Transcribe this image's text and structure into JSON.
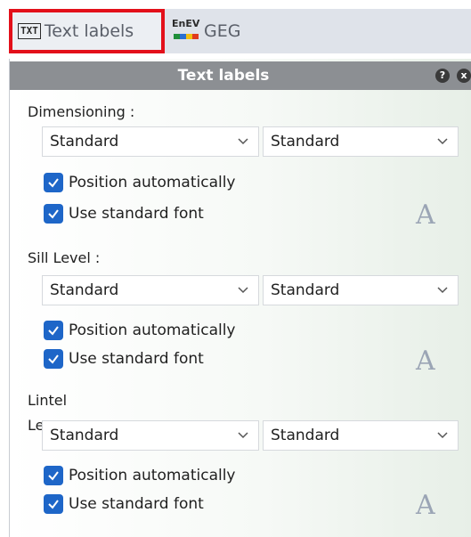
{
  "tabs": [
    {
      "icon": "TXT",
      "label": "Text labels",
      "selected": true
    },
    {
      "icon": "EnEV",
      "label": "GEG",
      "selected": false
    }
  ],
  "colors": {
    "highlight": "#e3101a",
    "checkbox": "#1e66c8",
    "header": "#8c8f93"
  },
  "panel": {
    "title": "Text labels",
    "help_icon": "?",
    "close_icon": "x",
    "sections": [
      {
        "label": "Dimensioning :",
        "select_left": "Standard",
        "select_right": "Standard",
        "position_automatically": {
          "label": "Position automatically",
          "checked": true
        },
        "use_standard_font": {
          "label": "Use standard font",
          "checked": true
        },
        "font_icon": "A"
      },
      {
        "label": "Sill Level :",
        "select_left": "Standard",
        "select_right": "Standard",
        "position_automatically": {
          "label": "Position automatically",
          "checked": true
        },
        "use_standard_font": {
          "label": "Use standard font",
          "checked": true
        },
        "font_icon": "A"
      },
      {
        "label": "Lintel",
        "label_overlap": "Le",
        "select_left": "Standard",
        "select_right": "Standard",
        "position_automatically": {
          "label": "Position automatically",
          "checked": true
        },
        "use_standard_font": {
          "label": "Use standard font",
          "checked": true
        },
        "font_icon": "A"
      }
    ]
  }
}
